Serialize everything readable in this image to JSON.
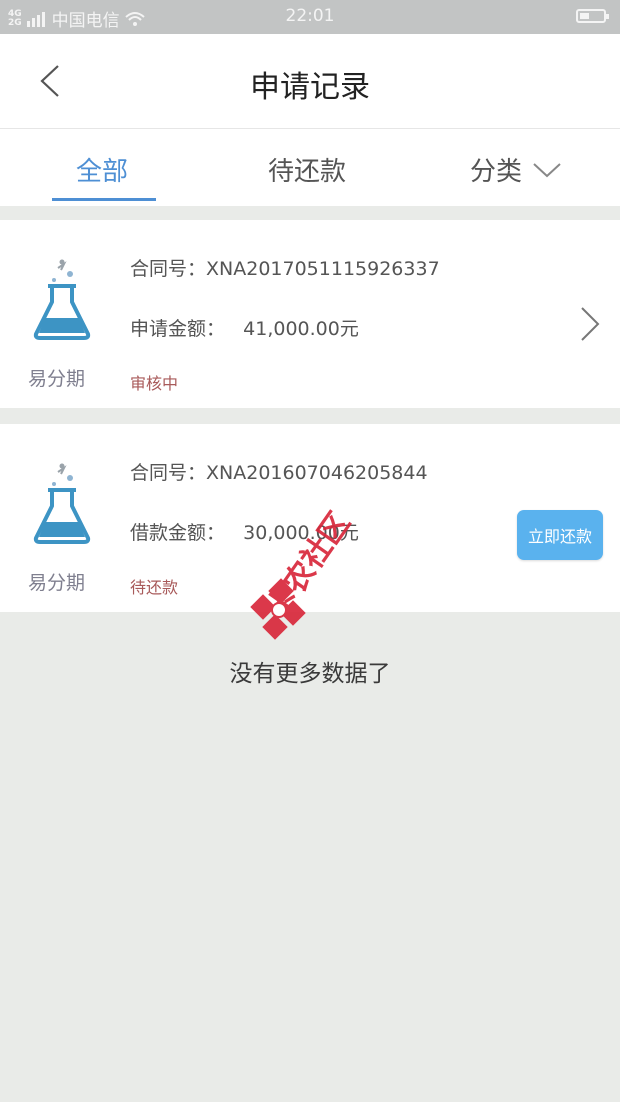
{
  "status_bar": {
    "network": "4G\n2G",
    "carrier": "中国电信",
    "time": "22:01"
  },
  "header": {
    "title": "申请记录"
  },
  "tabs": {
    "all": "全部",
    "pending_repay": "待还款",
    "category": "分类"
  },
  "records": [
    {
      "brand": "易分期",
      "contract_label": "合同号：",
      "contract_no": "XNA2017051115926337",
      "amount_label": "申请金额：",
      "amount": "41,000.00元",
      "status": "审核中"
    },
    {
      "brand": "易分期",
      "contract_label": "合同号：",
      "contract_no": "XNA2016070462058​44",
      "amount_label": "借款金额：",
      "amount": "30,000.00元",
      "status": "待还款",
      "button": "立即还款"
    }
  ],
  "footer": {
    "no_more": "没有更多数据了"
  },
  "watermark": {
    "text": "卡农社区"
  },
  "colors": {
    "accent": "#4e8fd4",
    "button": "#5ab2ee",
    "status_text": "#a85a5a",
    "flask": "#3d94c4"
  }
}
